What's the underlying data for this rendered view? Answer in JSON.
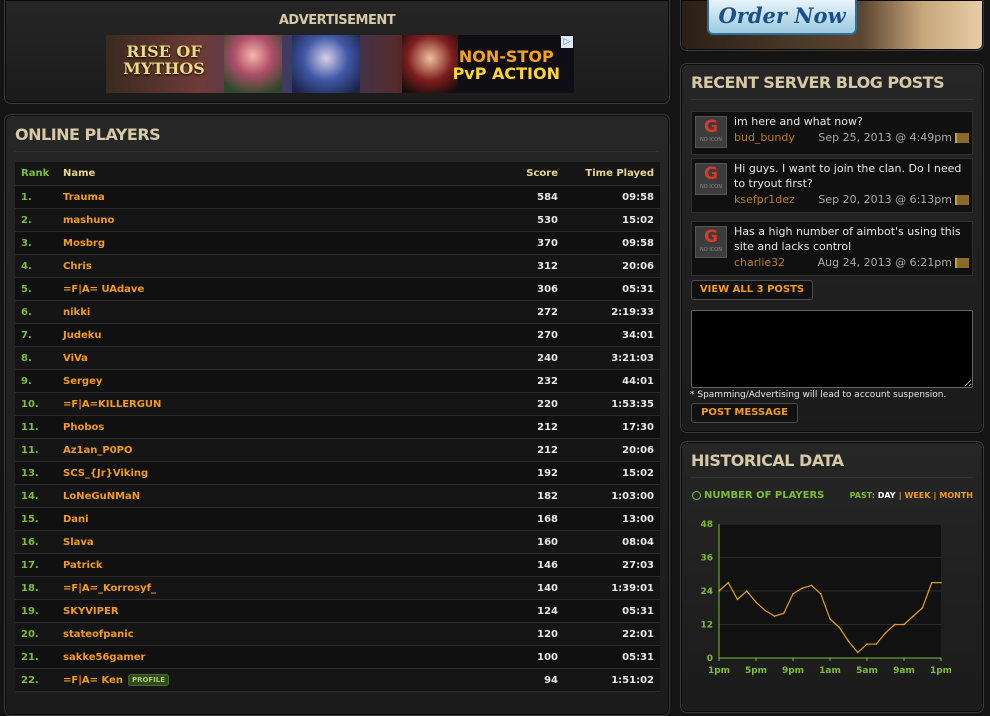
{
  "ad": {
    "label": "ADVERTISEMENT",
    "game_name": "RISE OF MYTHOS",
    "slogan_line1": "NON-STOP",
    "slogan_line2": "PvP ACTION",
    "choices_icon": "ad-choices-icon"
  },
  "promo": {
    "order_label": "Order Now"
  },
  "players": {
    "title": "ONLINE PLAYERS",
    "columns": [
      "Rank",
      "Name",
      "Score",
      "Time Played"
    ],
    "profile_badge": "PROFILE",
    "rows": [
      {
        "rank": "1.",
        "name": "Trauma",
        "score": "584",
        "time": "09:58"
      },
      {
        "rank": "2.",
        "name": "mashuno",
        "score": "530",
        "time": "15:02"
      },
      {
        "rank": "3.",
        "name": "Mosbrg",
        "score": "370",
        "time": "09:58"
      },
      {
        "rank": "4.",
        "name": "Chris",
        "score": "312",
        "time": "20:06"
      },
      {
        "rank": "5.",
        "name": "=F|A= UAdave",
        "score": "306",
        "time": "05:31"
      },
      {
        "rank": "6.",
        "name": "nikki",
        "score": "272",
        "time": "2:19:33"
      },
      {
        "rank": "7.",
        "name": "Judeku",
        "score": "270",
        "time": "34:01"
      },
      {
        "rank": "8.",
        "name": "ViVa",
        "score": "240",
        "time": "3:21:03"
      },
      {
        "rank": "9.",
        "name": "Sergey",
        "score": "232",
        "time": "44:01"
      },
      {
        "rank": "10.",
        "name": "=F|A=KILLERGUN",
        "score": "220",
        "time": "1:53:35"
      },
      {
        "rank": "11.",
        "name": "Phobos",
        "score": "212",
        "time": "17:30"
      },
      {
        "rank": "11.",
        "name": "Az1an_P0PO",
        "score": "212",
        "time": "20:06"
      },
      {
        "rank": "13.",
        "name": "SCS_{Jr}Viking",
        "score": "192",
        "time": "15:02"
      },
      {
        "rank": "14.",
        "name": "LoNeGuNMaN",
        "score": "182",
        "time": "1:03:00"
      },
      {
        "rank": "15.",
        "name": "Dani",
        "score": "168",
        "time": "13:00"
      },
      {
        "rank": "16.",
        "name": "Slava",
        "score": "160",
        "time": "08:04"
      },
      {
        "rank": "17.",
        "name": "Patrick",
        "score": "146",
        "time": "27:03"
      },
      {
        "rank": "18.",
        "name": "=F|A=_Korrosyf_",
        "score": "140",
        "time": "1:39:01"
      },
      {
        "rank": "19.",
        "name": "SKYVIPER",
        "score": "124",
        "time": "05:31"
      },
      {
        "rank": "20.",
        "name": "stateofpanic",
        "score": "120",
        "time": "22:01"
      },
      {
        "rank": "21.",
        "name": "sakke56gamer",
        "score": "100",
        "time": "05:31"
      },
      {
        "rank": "22.",
        "name": "=F|A= Ken",
        "score": "94",
        "time": "1:51:02",
        "profile": true
      }
    ]
  },
  "blog": {
    "title": "RECENT SERVER BLOG POSTS",
    "posts": [
      {
        "text": "im here and what now?",
        "author": "bud_bundy",
        "date": "Sep 25, 2013 @ 4:49pm"
      },
      {
        "text": "Hi guys. I want to join the clan. Do I need to tryout first?",
        "author": "ksefpr1dez",
        "date": "Sep 20, 2013 @ 6:13pm"
      },
      {
        "text": "Has a high number of aimbot's using this site and lacks control",
        "author": "charlie32",
        "date": "Aug 24, 2013 @ 6:21pm"
      }
    ],
    "avatar_letter": "G",
    "avatar_caption": "NO ICON",
    "view_all_label": "VIEW ALL 3 POSTS",
    "message_value": "",
    "spam_note": "* Spamming/Advertising will lead to account suspension.",
    "post_button_label": "POST MESSAGE"
  },
  "historical": {
    "title": "HISTORICAL DATA",
    "metric_label": "NUMBER OF PLAYERS",
    "range_prefix": "PAST:",
    "range_options": [
      "DAY",
      "WEEK",
      "MONTH"
    ],
    "range_selected": "DAY"
  },
  "colors": {
    "accent_orange": "#f29b1d",
    "accent_green": "#7dbd3a",
    "title_beige": "#d7c9a6",
    "chart_line": "#e0a020"
  },
  "chart_data": {
    "type": "line",
    "x_tick_labels": [
      "1pm",
      "5pm",
      "9pm",
      "1am",
      "5am",
      "9am",
      "1pm"
    ],
    "y_tick_labels": [
      "0",
      "12",
      "24",
      "36",
      "48"
    ],
    "ylim": [
      0,
      48
    ],
    "x_hours": [
      0,
      1,
      2,
      3,
      4,
      5,
      6,
      7,
      8,
      9,
      10,
      11,
      12,
      13,
      14,
      15,
      16,
      17,
      18,
      19,
      20,
      21,
      22,
      23,
      24
    ],
    "values": [
      24,
      27,
      21,
      24,
      20,
      17,
      15,
      16,
      23,
      25,
      26,
      23,
      14,
      11,
      6,
      2,
      5,
      5,
      9,
      12,
      12,
      15,
      18,
      27,
      27
    ]
  }
}
